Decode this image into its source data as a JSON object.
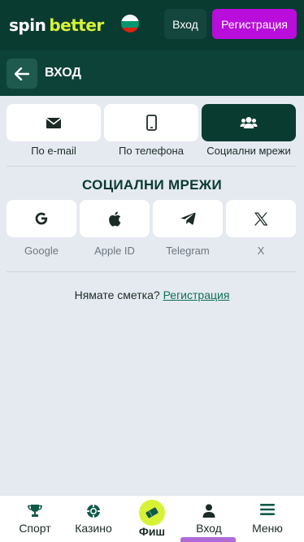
{
  "header": {
    "logo_spin": "spin",
    "logo_better": "better",
    "flag_icon": "bulgaria-flag-icon",
    "login_label": "Вход",
    "register_label": "Регистрация"
  },
  "subheader": {
    "title": "ВХОД",
    "back_icon": "arrow-left-icon"
  },
  "methods": [
    {
      "label": "По e-mail",
      "icon": "envelope-icon",
      "active": false
    },
    {
      "label": "По телефона",
      "icon": "phone-icon",
      "active": false
    },
    {
      "label": "Социални мрежи",
      "icon": "users-icon",
      "active": true
    }
  ],
  "social": {
    "title": "СОЦИАЛНИ МРЕЖИ",
    "items": [
      {
        "label": "Google",
        "icon": "google-icon"
      },
      {
        "label": "Apple ID",
        "icon": "apple-icon"
      },
      {
        "label": "Telegram",
        "icon": "telegram-icon"
      },
      {
        "label": "X",
        "icon": "x-icon"
      }
    ]
  },
  "no_account": {
    "text": "Нямате сметка?",
    "link": "Регистрация"
  },
  "bottom_nav": [
    {
      "label": "Спорт",
      "icon": "trophy-icon"
    },
    {
      "label": "Казино",
      "icon": "casino-chip-icon"
    },
    {
      "label": "Фиш",
      "icon": "ticket-icon"
    },
    {
      "label": "Вход",
      "icon": "user-icon",
      "active": true
    },
    {
      "label": "Меню",
      "icon": "menu-icon"
    }
  ],
  "colors": {
    "header_bg": "#0a3b31",
    "accent_green": "#d7f236",
    "register_purple": "#b80ddb",
    "page_bg": "#e5eaf0"
  }
}
